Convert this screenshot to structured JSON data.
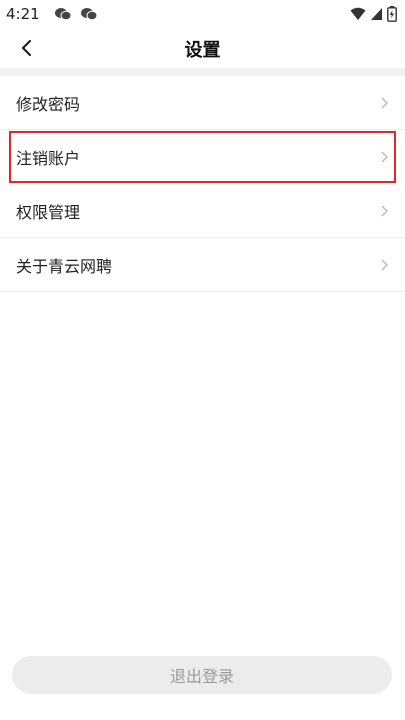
{
  "status_bar": {
    "time": "4:21"
  },
  "header": {
    "title": "设置"
  },
  "menu": {
    "items": [
      {
        "label": "修改密码"
      },
      {
        "label": "注销账户"
      },
      {
        "label": "权限管理"
      },
      {
        "label": "关于青云网聘"
      }
    ]
  },
  "footer": {
    "logout_label": "退出登录"
  },
  "colors": {
    "highlight_border": "#e0282c",
    "logout_bg": "#ececec",
    "logout_text": "#999999"
  }
}
